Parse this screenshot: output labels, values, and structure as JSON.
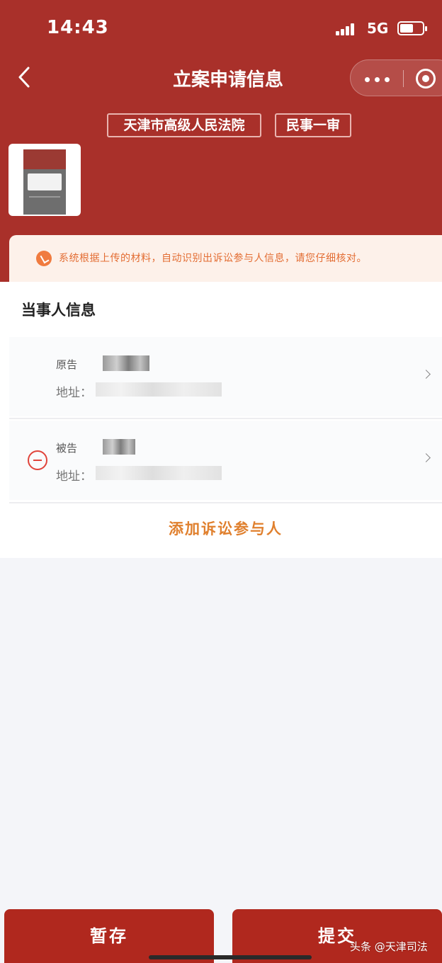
{
  "status_bar": {
    "time": "14:43",
    "network": "5G"
  },
  "navbar": {
    "title": "立案申请信息"
  },
  "tags": {
    "court": "天津市高级人民法院",
    "case_type": "民事一审"
  },
  "notice": {
    "text": "系统根据上传的材料，自动识别出诉讼参与人信息，请您仔细核对。"
  },
  "parties": {
    "section_title": "当事人信息",
    "items": [
      {
        "role": "原告",
        "address_label": "地址："
      },
      {
        "role": "被告",
        "address_label": "地址："
      }
    ],
    "add_label": "添加诉讼参与人"
  },
  "actions": {
    "save_label": "暂存",
    "submit_label": "提交"
  },
  "watermark": {
    "text": "头条 @天津司法"
  },
  "colors": {
    "header_red": "#a9302a",
    "button_red": "#b0281e",
    "accent_orange": "#e0802e",
    "notice_bg": "#fdf1ea"
  }
}
